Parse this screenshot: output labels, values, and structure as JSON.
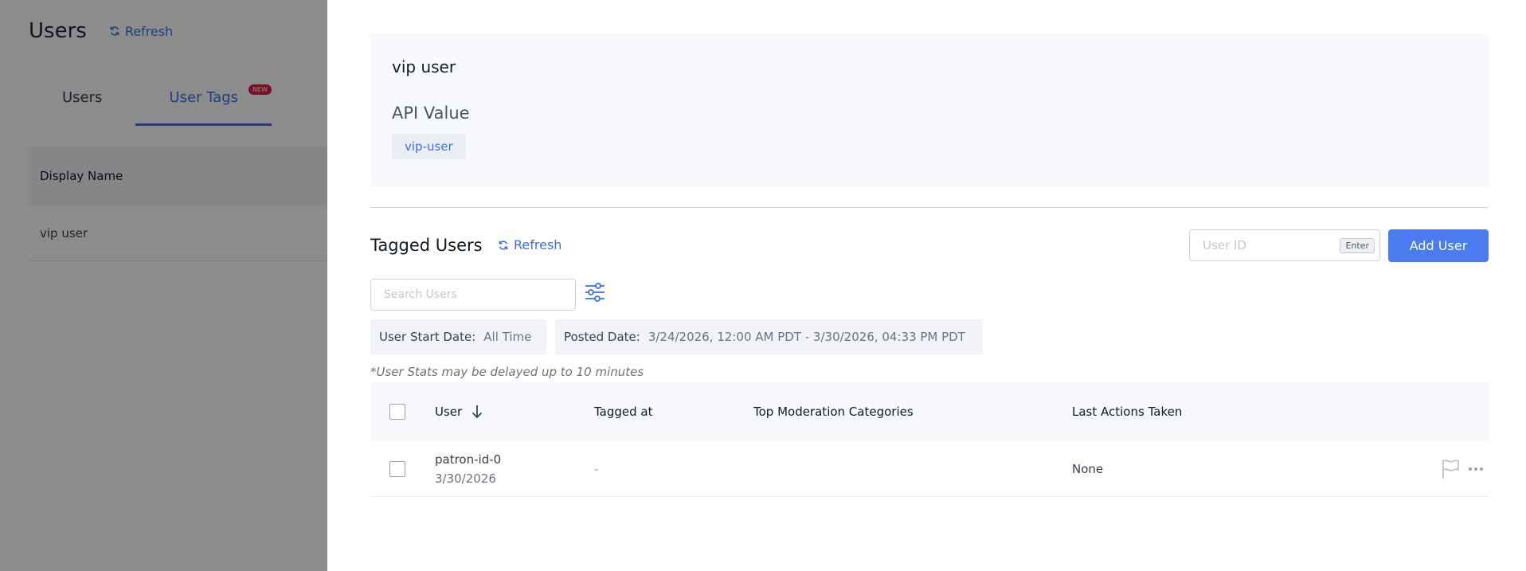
{
  "background": {
    "title": "Users",
    "refresh_label": "Refresh",
    "tabs": [
      {
        "label": "Users"
      },
      {
        "label": "User Tags",
        "badge": "NEW"
      }
    ],
    "table": {
      "header": "Display Name",
      "rows": [
        "vip user"
      ]
    }
  },
  "drawer": {
    "tag_name": "vip user",
    "api_value_label": "API Value",
    "api_value": "vip-user",
    "tagged_users_title": "Tagged Users",
    "refresh_label": "Refresh",
    "user_id_placeholder": "User ID",
    "enter_key": "Enter",
    "add_user_label": "Add User",
    "search_placeholder": "Search Users",
    "filters": {
      "start_date_label": "User Start Date:",
      "start_date_value": "All Time",
      "posted_date_label": "Posted Date:",
      "posted_date_value": "3/24/2026, 12:00 AM PDT - 3/30/2026, 04:33 PM PDT"
    },
    "stats_note": "*User Stats may be delayed up to 10 minutes",
    "columns": {
      "user": "User",
      "tagged_at": "Tagged at",
      "top_categories": "Top Moderation Categories",
      "last_actions": "Last Actions Taken"
    },
    "rows": [
      {
        "user_id": "patron-id-0",
        "user_date": "3/30/2026",
        "tagged_at": "-",
        "top_categories": "",
        "last_actions": "None"
      }
    ]
  },
  "colors": {
    "accent": "#3b6fe6",
    "button": "#4a7cf0",
    "overlay": "rgba(0,0,0,0.45)",
    "badge": "#e11d48"
  }
}
